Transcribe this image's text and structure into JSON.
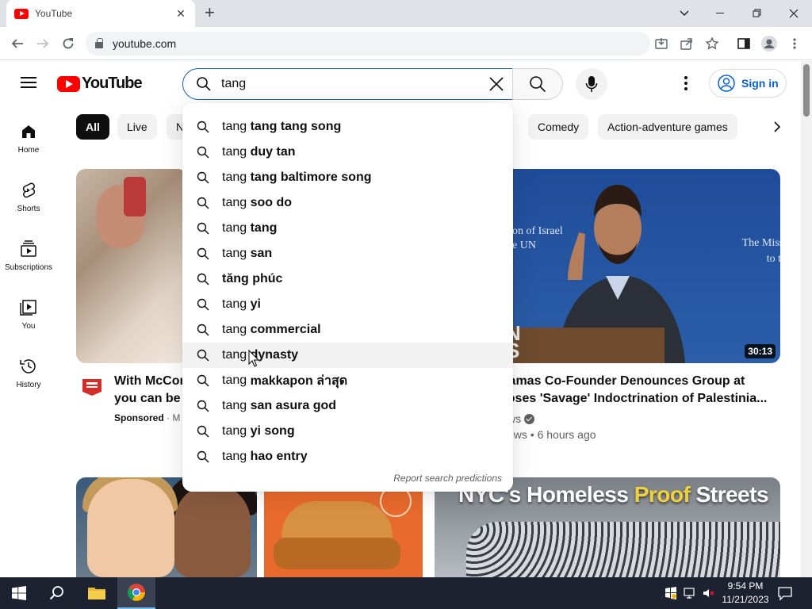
{
  "browser": {
    "tab_title": "YouTube",
    "tab_close": "✕",
    "new_tab": "+",
    "url": "youtube.com"
  },
  "youtube": {
    "logo_text": "YouTube",
    "search": {
      "value": "tang"
    },
    "sign_in": "Sign in",
    "guide": [
      {
        "label": "Home"
      },
      {
        "label": "Shorts"
      },
      {
        "label": "Subscriptions"
      },
      {
        "label": "You"
      },
      {
        "label": "History"
      }
    ],
    "chips": [
      "All",
      "Live",
      "N",
      "Comedy",
      "Action-adventure games"
    ],
    "suggestions": [
      {
        "typed": "tang ",
        "rest": "tang tang song"
      },
      {
        "typed": "tang ",
        "rest": "duy tan"
      },
      {
        "typed": "tang ",
        "rest": "tang baltimore song"
      },
      {
        "typed": "tang ",
        "rest": "soo do"
      },
      {
        "typed": "tang ",
        "rest": "tang"
      },
      {
        "typed": "tang ",
        "rest": "san"
      },
      {
        "typed": "",
        "rest": "tăng phúc"
      },
      {
        "typed": "tang ",
        "rest": "yi"
      },
      {
        "typed": "tang ",
        "rest": "commercial"
      },
      {
        "typed": "tang ",
        "rest": "dynasty"
      },
      {
        "typed": "tang ",
        "rest": "makkapon ล่าสุด"
      },
      {
        "typed": "tang ",
        "rest": "san asura god"
      },
      {
        "typed": "tang ",
        "rest": "yi song"
      },
      {
        "typed": "tang ",
        "rest": "hao entry"
      }
    ],
    "report_link": "Report search predictions",
    "video1": {
      "title_line1": "With McCor",
      "title_line2": "you can be s",
      "sponsored": "Sponsored",
      "meta_rest": " · M"
    },
    "video2": {
      "duration": "30:13",
      "title_line1": "Hamas Co-Founder Denounces Group at",
      "title_line2": "poses 'Savage' Indoctrination of Palestinia...",
      "channel": "ws",
      "meta": "ews • 6 hours ago",
      "sign_left": "on of Israel\ne UN",
      "sign_right": "The Missi\nto th",
      "podium_text": "N\nS"
    },
    "row2_headline": {
      "part1": "NYC's Homeless ",
      "highlight": "Proof",
      "part2": " Streets"
    }
  },
  "taskbar": {
    "time": "9:54 PM",
    "date": "11/21/2023"
  }
}
